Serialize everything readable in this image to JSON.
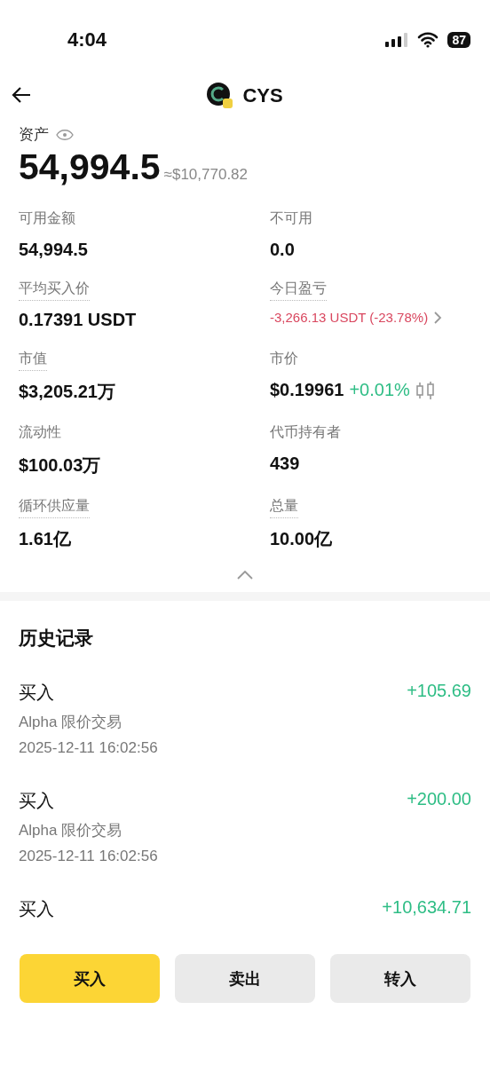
{
  "status_bar": {
    "time": "4:04",
    "battery": "87"
  },
  "header": {
    "title": "CYS"
  },
  "assets": {
    "label": "资产",
    "amount": "54,994.5",
    "approx": "≈$10,770.82"
  },
  "stats": [
    {
      "kind": "plain",
      "label": "可用金额",
      "dotted": false,
      "value": "54,994.5"
    },
    {
      "kind": "plain",
      "label": "不可用",
      "dotted": false,
      "value": "0.0"
    },
    {
      "kind": "plain",
      "label": "平均买入价",
      "dotted": true,
      "value": "0.17391 USDT"
    },
    {
      "kind": "pnl",
      "label": "今日盈亏",
      "dotted": true,
      "value": "-3,266.13 USDT (-23.78%)"
    },
    {
      "kind": "plain",
      "label": "市值",
      "dotted": true,
      "value": "$3,205.21万"
    },
    {
      "kind": "price",
      "label": "市价",
      "dotted": false,
      "value": "$0.19961",
      "change": "+0.01%"
    },
    {
      "kind": "plain",
      "label": "流动性",
      "dotted": false,
      "value": "$100.03万"
    },
    {
      "kind": "plain",
      "label": "代币持有者",
      "dotted": false,
      "value": "439"
    },
    {
      "kind": "plain",
      "label": "循环供应量",
      "dotted": true,
      "value": "1.61亿"
    },
    {
      "kind": "plain",
      "label": "总量",
      "dotted": true,
      "value": "10.00亿"
    }
  ],
  "history": {
    "title": "历史记录",
    "records": [
      {
        "type": "买入",
        "amount": "+105.69",
        "source": "Alpha 限价交易",
        "time": "2025-12-11 16:02:56"
      },
      {
        "type": "买入",
        "amount": "+200.00",
        "source": "Alpha 限价交易",
        "time": "2025-12-11 16:02:56"
      },
      {
        "type": "买入",
        "amount": "+10,634.71"
      }
    ]
  },
  "actions": [
    {
      "label": "买入",
      "primary": true
    },
    {
      "label": "卖出",
      "primary": false
    },
    {
      "label": "转入",
      "primary": false
    }
  ]
}
